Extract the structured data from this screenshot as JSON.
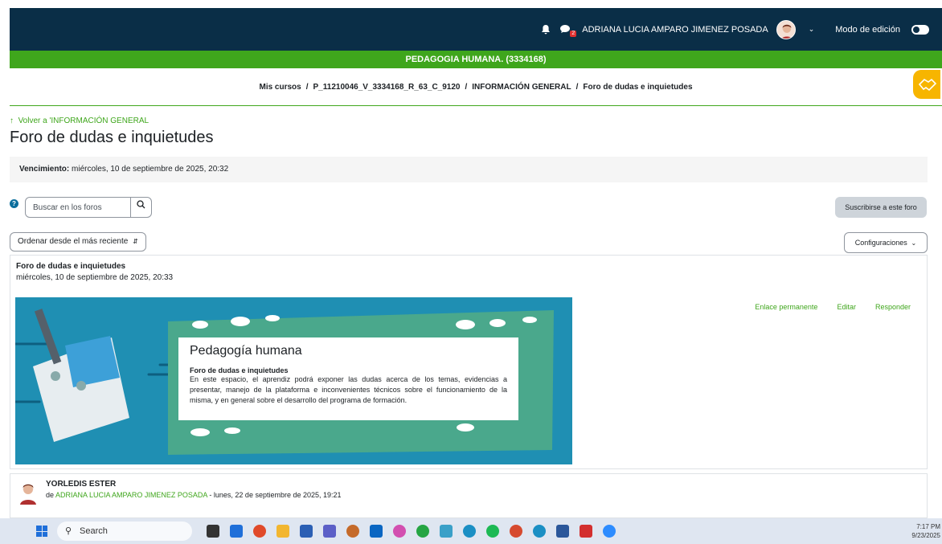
{
  "topbar": {
    "user_name": "ADRIANA LUCIA AMPARO JIMENEZ POSADA",
    "message_count": "2",
    "edit_mode_label": "Modo de edición"
  },
  "course": {
    "title": "PEDAGOGIA HUMANA. (3334168)"
  },
  "breadcrumb": {
    "items": [
      "Mis cursos",
      "P_11210046_V_3334168_R_63_C_9120",
      "INFORMACIÓN GENERAL",
      "Foro de dudas e inquietudes"
    ],
    "separator": "/"
  },
  "page": {
    "back_link": "Volver a 'INFORMACIÓN GENERAL",
    "title": "Foro de dudas e inquietudes",
    "due_label": "Vencimiento:",
    "due_value": " miércoles, 10 de septiembre de 2025, 20:32"
  },
  "toolbar": {
    "search_placeholder": "Buscar en los foros",
    "subscribe_label": "Suscribirse a este foro",
    "sort_label": "Ordenar desde el más reciente",
    "settings_label": "Configuraciones"
  },
  "post": {
    "title": "Foro de dudas e inquietudes",
    "date": "miércoles, 10 de septiembre de 2025, 20:33",
    "actions": [
      "Enlace permanente",
      "Editar",
      "Responder"
    ],
    "banner": {
      "title": "Pedagogía humana",
      "subtitle": "Foro de dudas e inquietudes",
      "body": "En este espacio, el aprendiz podrá exponer las dudas acerca de los temas, evidencias a presentar, manejo de la plataforma e inconvenientes técnicos sobre el funcionamiento de la misma, y en general sobre el desarrollo del programa de formación."
    }
  },
  "reply": {
    "name": "YORLEDIS ESTER",
    "by_prefix": "de ",
    "author": "ADRIANA LUCIA AMPARO JIMENEZ POSADA",
    "date": " - lunes, 22 de septiembre de 2025, 19:21"
  },
  "taskbar": {
    "search_label": "Search",
    "time": "7:17 PM",
    "date": "9/23/2025"
  },
  "colors": {
    "navbar": "#0a2e47",
    "accent_green": "#3fa61c"
  }
}
